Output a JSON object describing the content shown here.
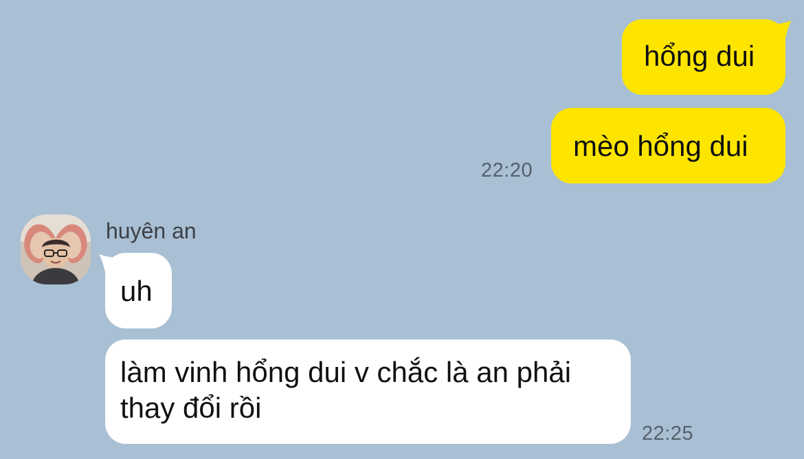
{
  "conversation": {
    "contact_name": "huyên an",
    "outgoing": [
      {
        "text": "hổng dui"
      },
      {
        "text": "mèo hổng dui",
        "time": "22:20"
      }
    ],
    "incoming": [
      {
        "text": "uh"
      },
      {
        "text_line1": "làm vinh hổng dui v chắc là an phải",
        "text_line2": "thay đổi rồi",
        "time": "22:25"
      }
    ]
  },
  "colors": {
    "background": "#A9BFD3",
    "outgoing_bubble": "#FEE500",
    "incoming_bubble": "#FFFFFF",
    "timestamp": "#55606B"
  },
  "icons": {
    "avatar": "contact-avatar-photo"
  }
}
